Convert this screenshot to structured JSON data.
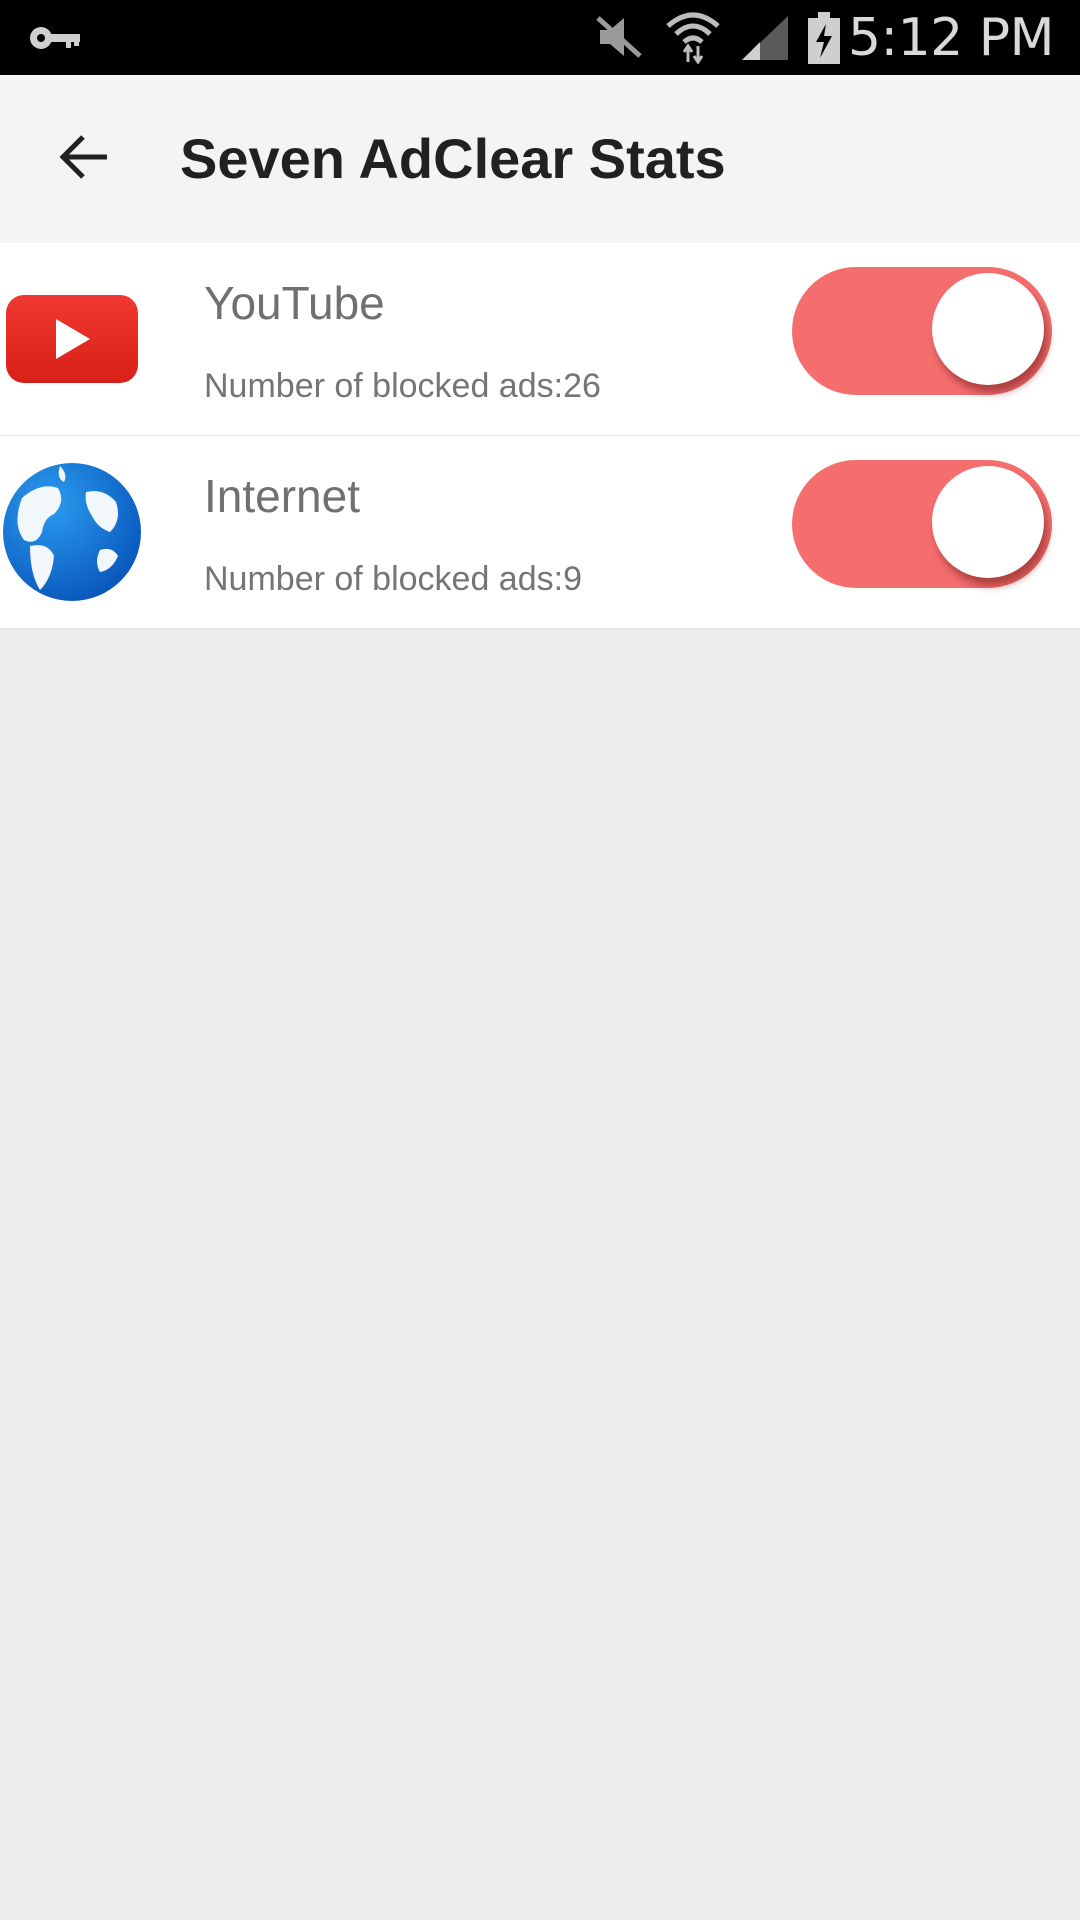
{
  "status_bar": {
    "time": "5:12 PM",
    "icons": [
      "vpn-key-icon",
      "mute-icon",
      "wifi-icon",
      "cell-signal-icon",
      "battery-charging-icon"
    ]
  },
  "app_bar": {
    "back_icon": "arrow-back-icon",
    "title": "Seven AdClear Stats"
  },
  "apps": [
    {
      "name": "YouTube",
      "blocked_label": "Number of blocked ads:26",
      "icon": "youtube-icon",
      "enabled": true
    },
    {
      "name": "Internet",
      "blocked_label": "Number of blocked ads:9",
      "icon": "globe-icon",
      "enabled": true
    }
  ],
  "colors": {
    "toggle_on": "#f56e6e",
    "status_bar": "#000000",
    "app_bar": "#f4f4f4",
    "background": "#ededed",
    "youtube_red": "#e62117",
    "globe_blue": "#0a6fcf"
  }
}
